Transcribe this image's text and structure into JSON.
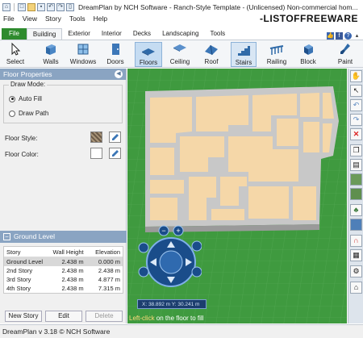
{
  "window": {
    "title": "DreamPlan by NCH Software - Ranch-Style Template - (Unlicensed) Non-commercial hom..."
  },
  "watermark": "-LISTOFFREEWARE",
  "menu": [
    "File",
    "View",
    "Story",
    "Tools",
    "Help"
  ],
  "ribbon_tabs": [
    "File",
    "Building",
    "Exterior",
    "Interior",
    "Decks",
    "Landscaping",
    "Tools"
  ],
  "active_tab": "Building",
  "tools": [
    "Select",
    "Walls",
    "Windows",
    "Doors",
    "Floors",
    "Ceiling",
    "Roof",
    "Stairs",
    "Railing",
    "Block",
    "Paint"
  ],
  "active_tool": "Floors",
  "floor_properties": {
    "header": "Floor Properties",
    "draw_mode_label": "Draw Mode:",
    "auto_fill": "Auto Fill",
    "draw_path": "Draw Path",
    "floor_style_label": "Floor Style:",
    "floor_color_label": "Floor Color:"
  },
  "ground_level": {
    "header": "Ground Level",
    "columns": [
      "Story",
      "Wall Height",
      "Elevation"
    ],
    "rows": [
      [
        "Ground Level",
        "2.438 m",
        "0.000 m"
      ],
      [
        "2nd Story",
        "2.438 m",
        "2.438 m"
      ],
      [
        "3rd Story",
        "2.438 m",
        "4.877 m"
      ],
      [
        "4th Story",
        "2.438 m",
        "7.315 m"
      ]
    ],
    "selected_row": 0,
    "buttons": {
      "new": "New Story",
      "edit": "Edit",
      "delete": "Delete"
    }
  },
  "view": {
    "coordinates": "X: 38.892 m    Y: 30.241 m",
    "hint_action": "Left-click",
    "hint_rest": " on the floor to fill"
  },
  "status": "DreamPlan v 3.18 © NCH Software",
  "colors": {
    "grass": "#3f9a3f",
    "floor": "#f5d7a8",
    "wall": "#c9c9c9",
    "header": "#8aa4c2",
    "file_tab": "#2e8b2e"
  }
}
